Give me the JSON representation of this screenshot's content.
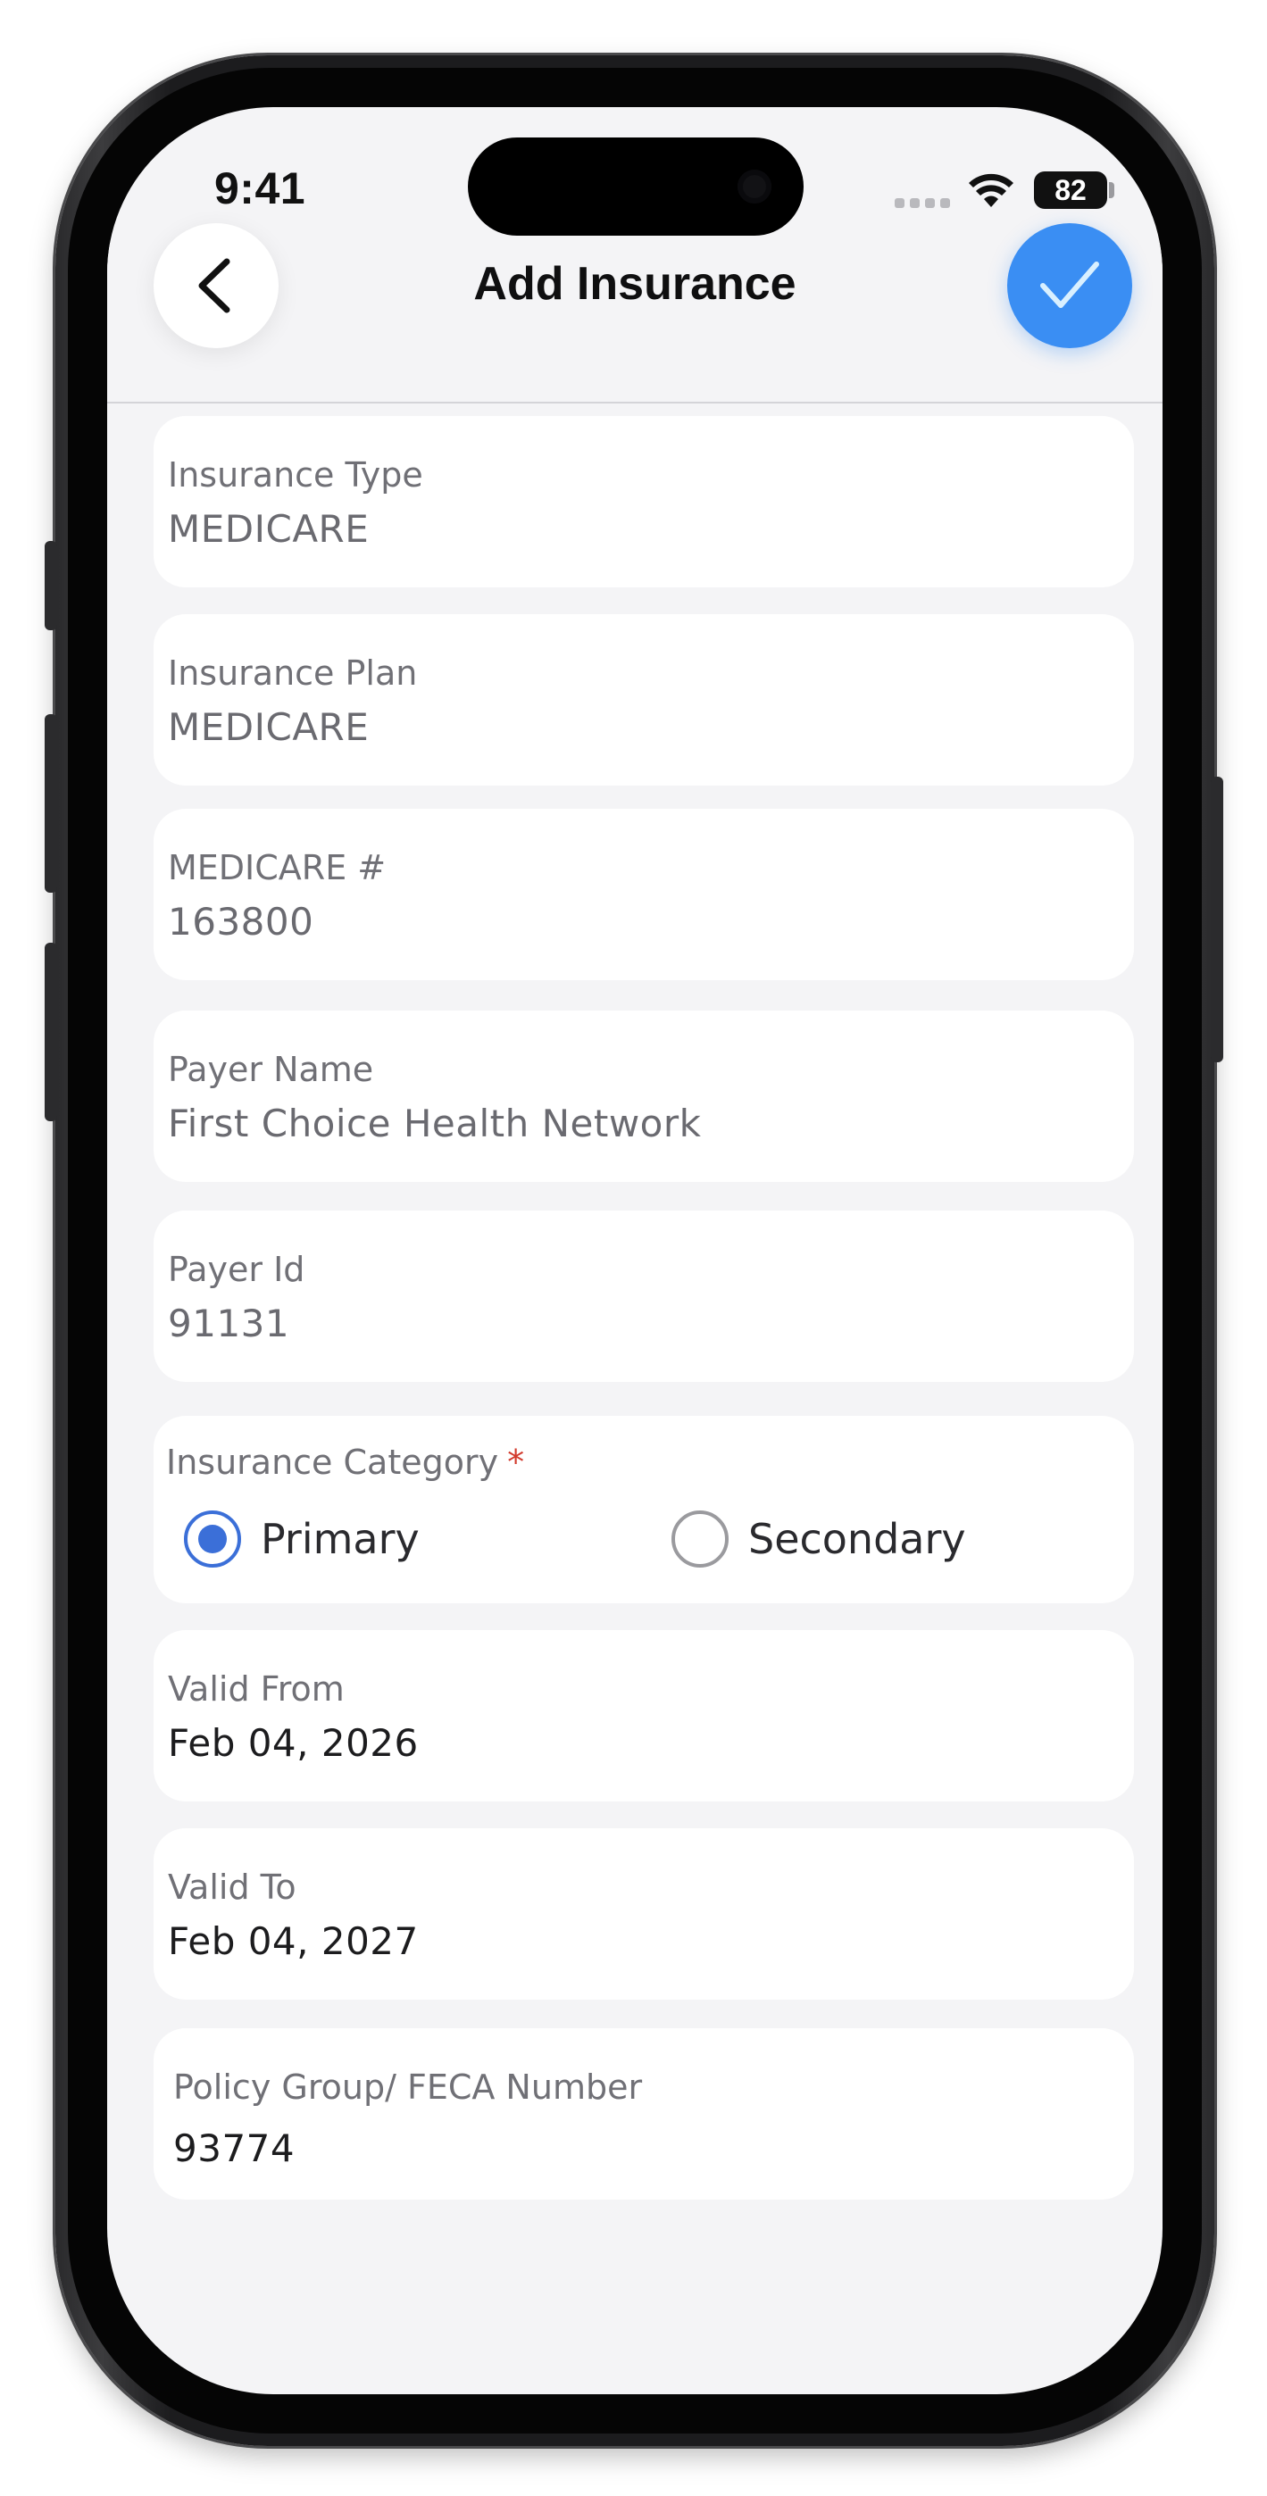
{
  "status_bar": {
    "time": "9:41",
    "battery": "82"
  },
  "header": {
    "title": "Add Insurance",
    "back_icon": "chevron-left-icon",
    "confirm_icon": "checkmark-icon",
    "confirm_color": "#3a8ef3"
  },
  "form": {
    "insurance_type": {
      "label": "Insurance Type",
      "value": "MEDICARE"
    },
    "insurance_plan": {
      "label": "Insurance Plan",
      "value": "MEDICARE"
    },
    "medicare_number": {
      "label": "MEDICARE #",
      "value": "163800"
    },
    "payer_name": {
      "label": "Payer Name",
      "value": "First Choice Health Network"
    },
    "payer_id": {
      "label": "Payer Id",
      "value": "91131"
    },
    "insurance_category": {
      "label": "Insurance Category",
      "required_mark": "*",
      "options": [
        {
          "label": "Primary",
          "selected": true
        },
        {
          "label": "Secondary",
          "selected": false
        }
      ]
    },
    "valid_from": {
      "label": "Valid From",
      "value": "Feb 04, 2026"
    },
    "valid_to": {
      "label": "Valid To",
      "value": "Feb 04, 2027"
    },
    "policy_group": {
      "label": "Policy Group/ FECA Number",
      "value": "93774"
    }
  }
}
